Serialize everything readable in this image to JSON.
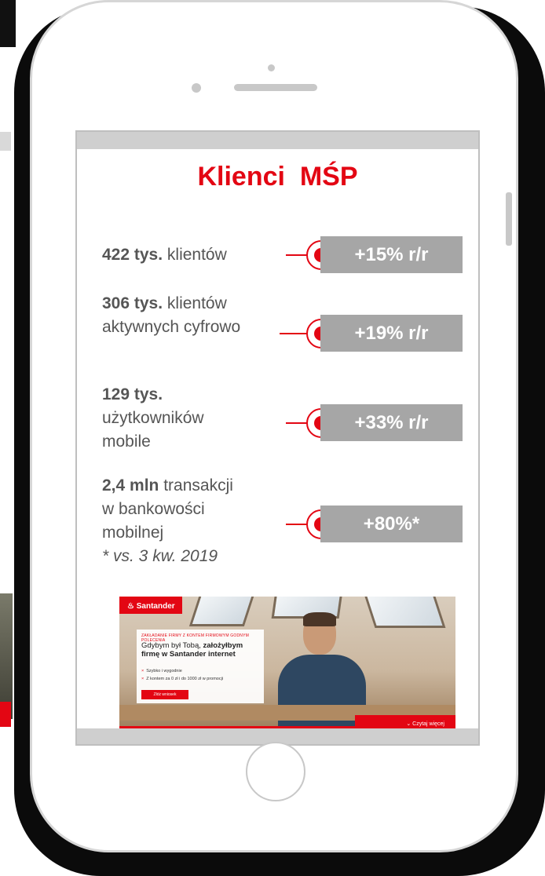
{
  "screen": {
    "title": "Klienci  MŚP"
  },
  "stats": [
    {
      "lines": [
        {
          "bold": "422 tys.",
          "text": " klientów"
        }
      ],
      "change": "+15% r/r"
    },
    {
      "lines": [
        {
          "bold": "306 tys.",
          "text": " klientów"
        },
        {
          "bold": "",
          "text": "aktywnych cyfrowo"
        }
      ],
      "change": "+19% r/r"
    },
    {
      "lines": [
        {
          "bold": "129 tys.",
          "text": ""
        },
        {
          "bold": "",
          "text": "użytkowników"
        },
        {
          "bold": "",
          "text": "mobile"
        }
      ],
      "change": "+33% r/r"
    },
    {
      "lines": [
        {
          "bold": "2,4 mln",
          "text": " transakcji"
        },
        {
          "bold": "",
          "text": "w bankowości"
        },
        {
          "bold": "",
          "text": "mobilnej"
        }
      ],
      "note": "* vs. 3 kw. 2019",
      "change": "+80%*"
    }
  ],
  "ad": {
    "brand": "Santander",
    "kicker": "ZAKŁADANIE FIRMY Z KONTEM FIRMOWYM GODNYM POLECENIA",
    "headline_regular": "Gdybym był Tobą, ",
    "headline_bold_1": "założyłbym",
    "headline_bold_2": "firmę w Santander internet",
    "bullet_1": "Szybko i wygodnie",
    "bullet_2": "Z kontem za 0 zł i do 1000 zł w promocji",
    "cta": "Złóż wniosek",
    "more": "Czytaj więcej"
  },
  "colors": {
    "accent": "#e30613",
    "badge": "#a6a6a6",
    "text": "#555555"
  }
}
